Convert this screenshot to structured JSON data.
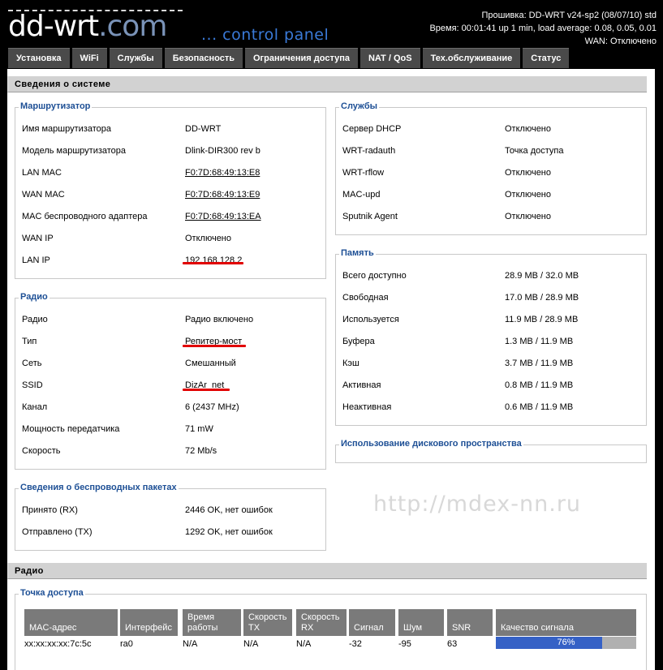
{
  "header": {
    "logo": "dd-wrt.com",
    "logo_main": "dd-wrt",
    "logo_suffix": ".com",
    "control_panel": "... control panel",
    "firmware": "Прошивка: DD-WRT v24-sp2 (08/07/10) std",
    "uptime": "Время: 00:01:41 up 1 min, load average: 0.08, 0.05, 0.01",
    "wan": "WAN: Отключено"
  },
  "tabs": [
    {
      "label": "Установка"
    },
    {
      "label": "WiFi"
    },
    {
      "label": "Службы"
    },
    {
      "label": "Безопасность"
    },
    {
      "label": "Ограничения доступа"
    },
    {
      "label": "NAT / QoS"
    },
    {
      "label": "Тех.обслуживание"
    },
    {
      "label": "Статус"
    }
  ],
  "system_info": {
    "title": "Сведения о системе",
    "router": {
      "legend": "Маршрутизатор",
      "rows": [
        {
          "label": "Имя маршрутизатора",
          "value": "DD-WRT"
        },
        {
          "label": "Модель маршрутизатора",
          "value": "Dlink-DIR300 rev b"
        },
        {
          "label": "LAN MAC",
          "value": "F0:7D:68:49:13:E8"
        },
        {
          "label": "WAN MAC",
          "value": "F0:7D:68:49:13:E9"
        },
        {
          "label": "MAC беспроводного адаптера",
          "value": "F0:7D:68:49:13:EA"
        },
        {
          "label": "WAN IP",
          "value": "Отключено"
        },
        {
          "label": "LAN IP",
          "value": "192.168.128.2"
        }
      ]
    },
    "services": {
      "legend": "Службы",
      "rows": [
        {
          "label": "Сервер DHCP",
          "value": "Отключено"
        },
        {
          "label": "WRT-radauth",
          "value": "Точка доступа"
        },
        {
          "label": "WRT-rflow",
          "value": "Отключено"
        },
        {
          "label": "MAC-upd",
          "value": "Отключено"
        },
        {
          "label": "Sputnik Agent",
          "value": "Отключено"
        }
      ]
    },
    "radio": {
      "legend": "Радио",
      "rows": [
        {
          "label": "Радио",
          "value": "Радио включено"
        },
        {
          "label": "Тип",
          "value": "Репитер-мост"
        },
        {
          "label": "Сеть",
          "value": "Смешанный"
        },
        {
          "label": "SSID",
          "value": "DizAr_net"
        },
        {
          "label": "Канал",
          "value": "6 (2437 MHz)"
        },
        {
          "label": "Мощность передатчика",
          "value": "71 mW"
        },
        {
          "label": "Скорость",
          "value": "72 Mb/s"
        }
      ]
    },
    "memory": {
      "legend": "Память",
      "rows": [
        {
          "label": "Всего доступно",
          "value": "28.9 MB / 32.0 MB"
        },
        {
          "label": "Свободная",
          "value": "17.0 MB / 28.9 MB"
        },
        {
          "label": "Используется",
          "value": "11.9 MB / 28.9 MB"
        },
        {
          "label": "Буфера",
          "value": "1.3 MB / 11.9 MB"
        },
        {
          "label": "Кэш",
          "value": "3.7 MB / 11.9 MB"
        },
        {
          "label": "Активная",
          "value": "0.8 MB / 11.9 MB"
        },
        {
          "label": "Неактивная",
          "value": "0.6 MB / 11.9 MB"
        }
      ]
    },
    "disk": {
      "legend": "Использование дискового пространства"
    },
    "packets": {
      "legend": "Сведения о беспроводных пакетах",
      "rows": [
        {
          "label": "Принято (RX)",
          "value": "2446 OK, нет ошибок"
        },
        {
          "label": "Отправлено (TX)",
          "value": "1292 OK, нет ошибок"
        }
      ]
    }
  },
  "watermark": "http://mdex-nn.ru",
  "radio_section": {
    "title": "Радио",
    "ap_legend": "Точка доступа",
    "columns": [
      {
        "top": "",
        "bottom": "MAC-адрес"
      },
      {
        "top": "",
        "bottom": "Интерфейс"
      },
      {
        "top": "Время",
        "bottom": "работы"
      },
      {
        "top": "Скорость",
        "bottom": "TX"
      },
      {
        "top": "Скорость",
        "bottom": "RX"
      },
      {
        "top": "",
        "bottom": "Сигнал"
      },
      {
        "top": "",
        "bottom": "Шум"
      },
      {
        "top": "",
        "bottom": "SNR"
      },
      {
        "top": "",
        "bottom": "Качество сигнала"
      }
    ],
    "row": {
      "mac": "xx:xx:xx:xx:7c:5c",
      "interface": "ra0",
      "uptime": "N/A",
      "tx": "N/A",
      "rx": "N/A",
      "signal": "-32",
      "noise": "-95",
      "snr": "63",
      "quality_percent": 76,
      "quality_label": "76%"
    }
  },
  "colors": {
    "accent": "#1d4f95",
    "tab_bg": "#4a4a4a",
    "bar_bg": "#d2d2d2",
    "quality_fill": "#3561c6",
    "highlight": "#e10000"
  }
}
